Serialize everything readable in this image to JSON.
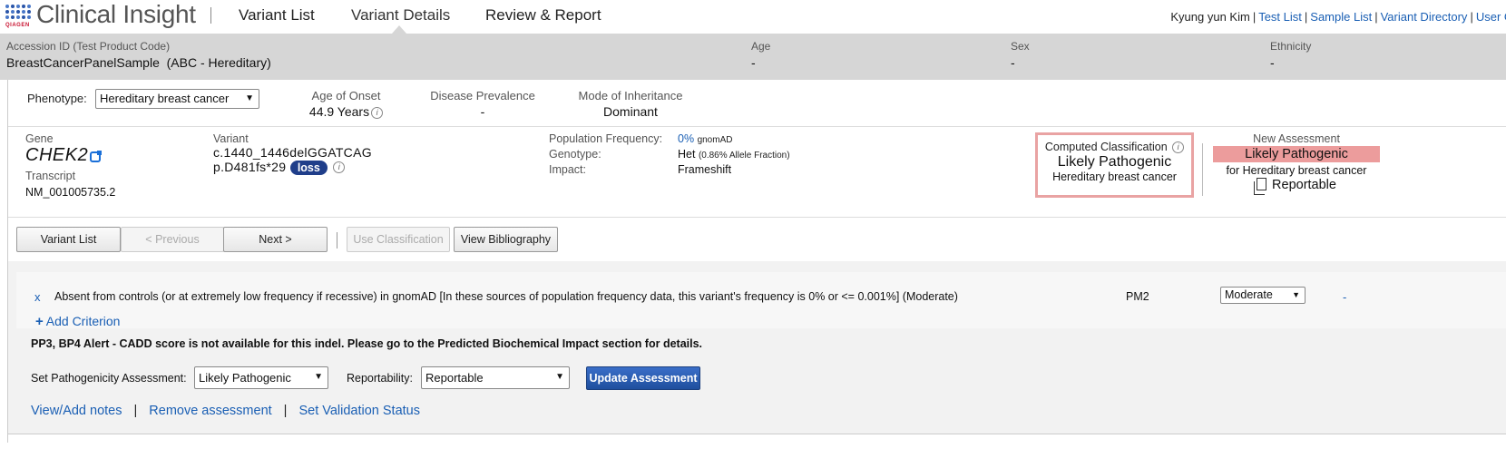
{
  "app": {
    "title": "Clinical Insight",
    "logo_small": "QIAGEN",
    "tabs": [
      "Variant List",
      "Variant Details",
      "Review & Report"
    ],
    "active_tab": "Variant Details",
    "user_name": "Kyung yun Kim",
    "user_links": [
      "Test List",
      "Sample List",
      "Variant Directory",
      "User G"
    ]
  },
  "sample": {
    "accession_label": "Accession ID (Test Product Code)",
    "accession_value": "BreastCancerPanelSample  (ABC - Hereditary)",
    "age_label": "Age",
    "age_value": "-",
    "sex_label": "Sex",
    "sex_value": "-",
    "ethnicity_label": "Ethnicity",
    "ethnicity_value": "-"
  },
  "phenotype": {
    "label": "Phenotype:",
    "selected": "Hereditary breast cancer",
    "age_onset_label": "Age of Onset",
    "age_onset_value": "44.9 Years",
    "prevalence_label": "Disease Prevalence",
    "prevalence_value": "-",
    "inheritance_label": "Mode of Inheritance",
    "inheritance_value": "Dominant"
  },
  "variant": {
    "gene_label": "Gene",
    "gene": "CHEK2",
    "transcript_label": "Transcript",
    "transcript": "NM_001005735.2",
    "variant_label": "Variant",
    "cdna": "c.1440_1446delGGATCAG",
    "protein": "p.D481fs*29",
    "badge": "loss",
    "pop_freq_label": "Population Frequency:",
    "pop_freq_value": "0%",
    "pop_freq_source": "gnomAD",
    "genotype_label": "Genotype:",
    "genotype_value": "Het",
    "genotype_detail": "(0.86% Allele Fraction)",
    "impact_label": "Impact:",
    "impact_value": "Frameshift"
  },
  "computed": {
    "label": "Computed Classification",
    "value": "Likely Pathogenic",
    "sub": "Hereditary breast cancer"
  },
  "new_assessment": {
    "label": "New Assessment",
    "value": "Likely Pathogenic",
    "for": "for Hereditary breast cancer",
    "reportable": "Reportable"
  },
  "buttons": {
    "variant_list": "Variant List",
    "previous": "< Previous",
    "next": "Next >",
    "use_classification": "Use Classification",
    "view_bibliography": "View Bibliography"
  },
  "criterion": {
    "remove": "x",
    "text": "Absent from controls (or at extremely low frequency if recessive) in gnomAD [In these sources of population frequency data, this variant's frequency is 0% or <= 0.001%] (Moderate)",
    "code": "PM2",
    "strength": "Moderate",
    "extra": "-",
    "add_label": "Add Criterion"
  },
  "alert": "PP3, BP4 Alert - CADD score is not available for this indel. Please go to the Predicted Biochemical Impact section for details.",
  "assessment": {
    "set_label": "Set Pathogenicity Assessment:",
    "set_value": "Likely Pathogenic",
    "report_label": "Reportability:",
    "report_value": "Reportable",
    "update_button": "Update Assessment"
  },
  "links": [
    "View/Add notes",
    "Remove assessment",
    "Set Validation Status"
  ],
  "colors": {
    "accent": "#1a5fb4",
    "band": "#d6d6d6",
    "pathogenic": "#ec9c9c"
  }
}
